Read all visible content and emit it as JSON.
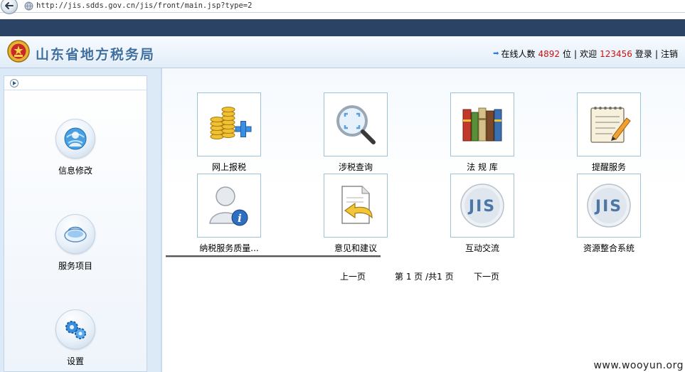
{
  "browser": {
    "url": "http://jis.sdds.gov.cn/jis/front/main.jsp?type=2"
  },
  "header": {
    "title": "山东省地方税务局",
    "online_label": "在线人数",
    "online_count": "4892",
    "online_unit": "位",
    "separator": "|",
    "welcome_label": "欢迎",
    "username": "123456",
    "login_label": "登录",
    "logout_label": "注销"
  },
  "sidebar": {
    "items": [
      {
        "label": "信息修改",
        "icon": "user-globe-icon"
      },
      {
        "label": "服务项目",
        "icon": "mouse-icon"
      },
      {
        "label": "设置",
        "icon": "gears-icon"
      }
    ]
  },
  "main": {
    "tiles": [
      {
        "label": "网上报税",
        "icon": "coins-plus-icon"
      },
      {
        "label": "涉税查询",
        "icon": "magnifier-icon"
      },
      {
        "label": "法 规 库",
        "icon": "books-icon"
      },
      {
        "label": "提醒服务",
        "icon": "notepad-pencil-icon"
      },
      {
        "label": "纳税服务质量...",
        "icon": "user-info-icon"
      },
      {
        "label": "意见和建议",
        "icon": "document-reply-icon"
      },
      {
        "label": "互动交流",
        "icon": "jis-logo-icon"
      },
      {
        "label": "资源整合系统",
        "icon": "jis-logo-icon"
      }
    ],
    "pager": {
      "prev": "上一页",
      "status": "第 1 页 /共1 页",
      "next": "下一页"
    }
  },
  "watermark": "www.wooyun.org",
  "colors": {
    "nav_strip": "#2b4466",
    "title": "#3f6fa1",
    "highlight_number": "#d01010",
    "tile_border": "#9dc3d9"
  }
}
